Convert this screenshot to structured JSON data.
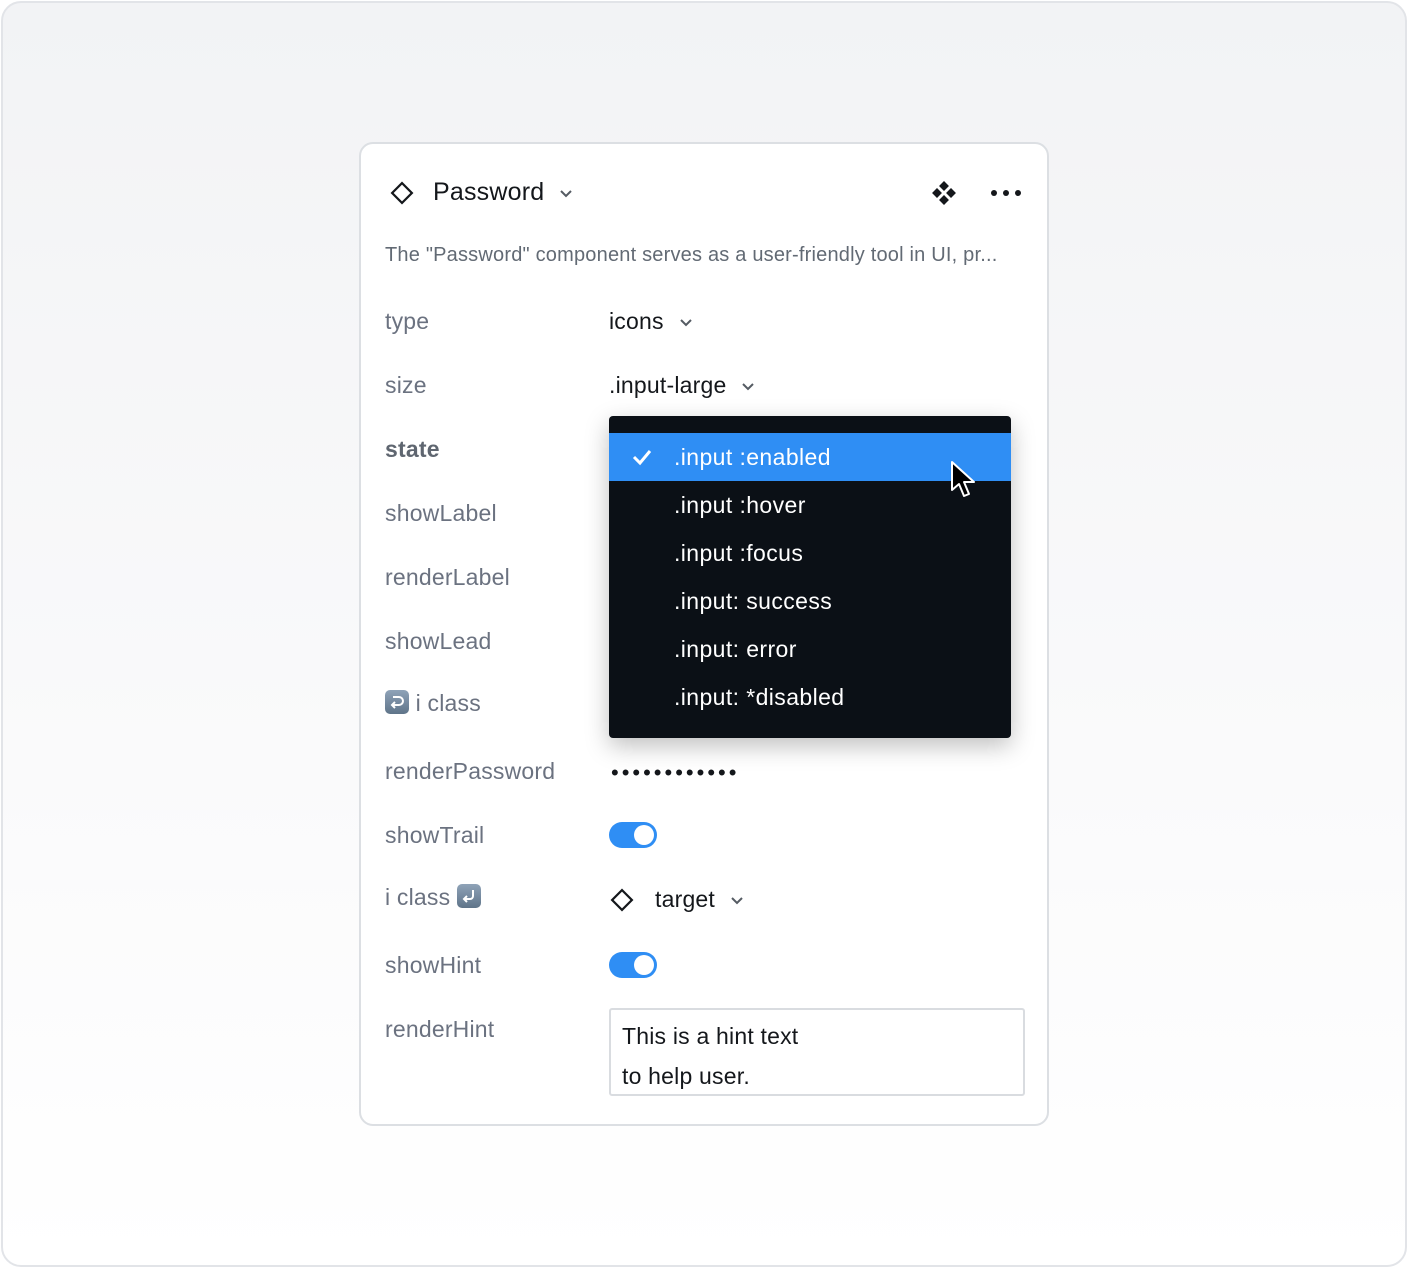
{
  "component": {
    "title": "Password",
    "description": "The \"Password\" component serves as a user-friendly tool in UI, pr..."
  },
  "header": {
    "component_icon": "diamond-outline-icon",
    "instance_icon": "component-instance-icon",
    "more_icon": "more-horizontal-icon"
  },
  "props": {
    "type": {
      "label": "type",
      "value": "icons"
    },
    "size": {
      "label": "size",
      "value": ".input-large"
    },
    "state": {
      "label": "state"
    },
    "showLabel": {
      "label": "showLabel",
      "on": true
    },
    "renderLabel": {
      "label": "renderLabel"
    },
    "showLead": {
      "label": "showLead",
      "on": true
    },
    "leadClass": {
      "label": "i class",
      "icon": "arrow-right-hook-icon"
    },
    "renderPassword": {
      "label": "renderPassword",
      "value": "••••••••••••"
    },
    "showTrail": {
      "label": "showTrail",
      "on": true
    },
    "trailClass": {
      "label": "i class",
      "icon": "return-arrow-icon",
      "value": "target"
    },
    "showHint": {
      "label": "showHint",
      "on": true
    },
    "renderHint": {
      "label": "renderHint",
      "lines": [
        "This is a hint text",
        "to help user."
      ]
    }
  },
  "dropdown": {
    "items": [
      {
        "label": ".input :enabled",
        "selected": true
      },
      {
        "label": ".input :hover",
        "selected": false
      },
      {
        "label": ".input :focus",
        "selected": false
      },
      {
        "label": ".input: success",
        "selected": false
      },
      {
        "label": ".input: error",
        "selected": false
      },
      {
        "label": ".input: *disabled",
        "selected": false
      }
    ]
  },
  "colors": {
    "accent": "#2f8ef4",
    "dropdown_bg": "#0b1016",
    "label_text": "#6b7280"
  }
}
